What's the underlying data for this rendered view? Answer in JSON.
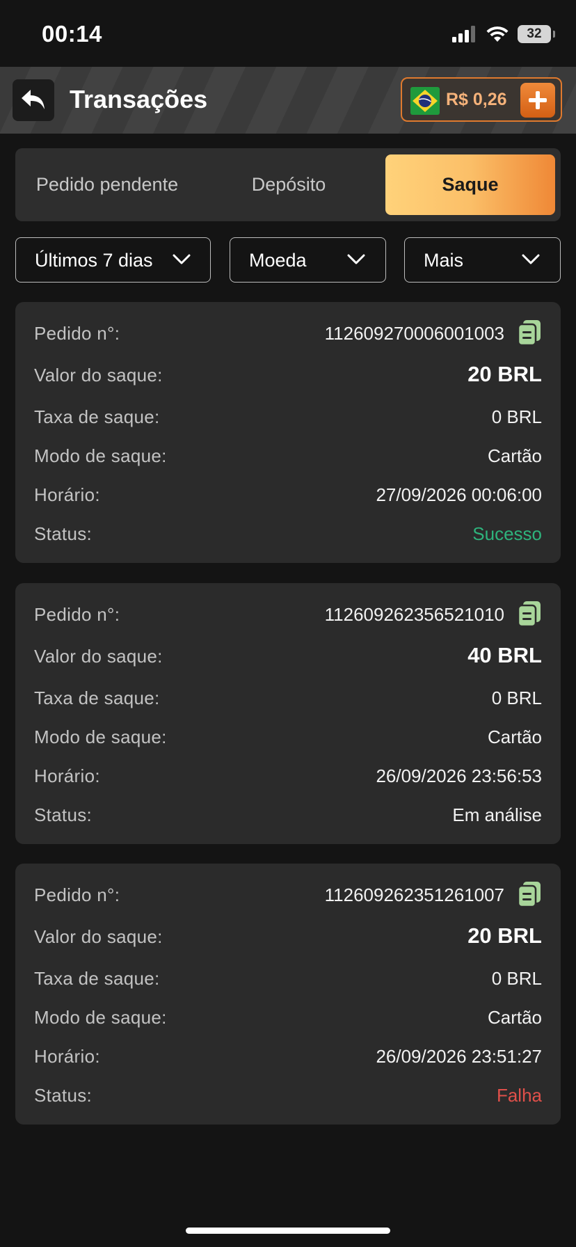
{
  "status_bar": {
    "time": "00:14",
    "battery": "32"
  },
  "header": {
    "title": "Transações",
    "balance": "R$ 0,26",
    "back_icon": "back-arrow-icon",
    "add_icon": "plus-icon",
    "flag_icon": "brazil-flag-icon"
  },
  "tabs": [
    {
      "label": "Pedido pendente",
      "active": false
    },
    {
      "label": "Depósito",
      "active": false
    },
    {
      "label": "Saque",
      "active": true
    }
  ],
  "filters": [
    {
      "label": "Últimos 7 dias"
    },
    {
      "label": "Moeda"
    },
    {
      "label": "Mais"
    }
  ],
  "labels": {
    "order": "Pedido n°:",
    "amount": "Valor do saque:",
    "fee": "Taxa de saque:",
    "mode": "Modo de saque:",
    "time": "Horário:",
    "status": "Status:"
  },
  "transactions": [
    {
      "order": "112609270006001003",
      "amount": "20 BRL",
      "fee": "0 BRL",
      "mode": "Cartão",
      "time": "27/09/2026 00:06:00",
      "status": "Sucesso"
    },
    {
      "order": "112609262356521010",
      "amount": "40 BRL",
      "fee": "0 BRL",
      "mode": "Cartão",
      "time": "26/09/2026 23:56:53",
      "status": "Em análise"
    },
    {
      "order": "112609262351261007",
      "amount": "20 BRL",
      "fee": "0 BRL",
      "mode": "Cartão",
      "time": "26/09/2026 23:51:27",
      "status": "Falha"
    }
  ],
  "colors": {
    "accent": "#ef8836",
    "success": "#2eb37c",
    "fail": "#e0504a",
    "copy_icon": "#a8d59a"
  }
}
